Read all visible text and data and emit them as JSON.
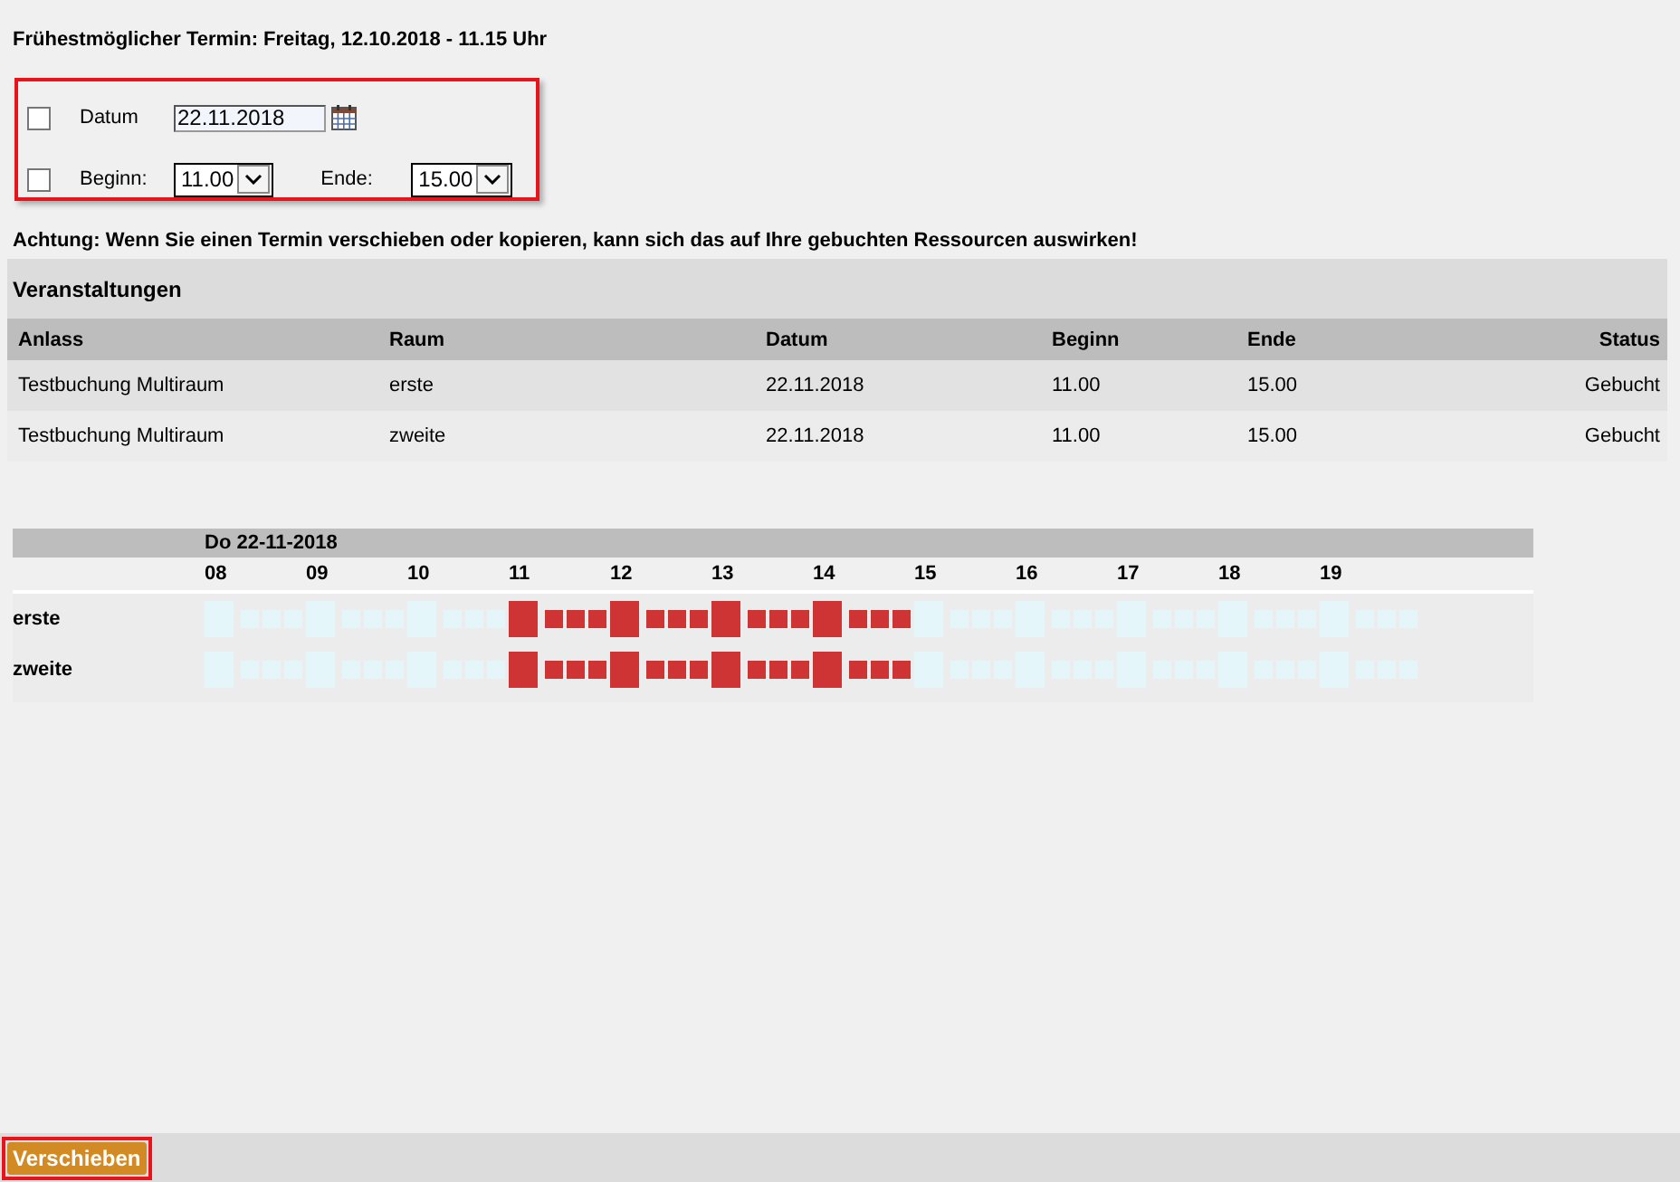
{
  "earliest_slot": "Frühestmöglicher Termin: Freitag, 12.10.2018 - 11.15 Uhr",
  "filter": {
    "date": {
      "label": "Datum",
      "checked": false,
      "value": "22.11.2018"
    },
    "start": {
      "label": "Beginn:",
      "checked": false,
      "value": "11.00"
    },
    "end": {
      "label": "Ende:",
      "value": "15.00"
    }
  },
  "warning": "Achtung: Wenn Sie einen Termin verschieben oder kopieren, kann sich das auf Ihre gebuchten Ressourcen auswirken!",
  "events": {
    "title": "Veranstaltungen",
    "columns": [
      "Anlass",
      "Raum",
      "Datum",
      "Beginn",
      "Ende",
      "Status"
    ],
    "rows": [
      [
        "Testbuchung Multiraum",
        "erste",
        "22.11.2018",
        "11.00",
        "15.00",
        "Gebucht"
      ],
      [
        "Testbuchung Multiraum",
        "zweite",
        "22.11.2018",
        "11.00",
        "15.00",
        "Gebucht"
      ]
    ]
  },
  "timeline": {
    "day": "Do 22-11-2018",
    "hours": [
      "08",
      "09",
      "10",
      "11",
      "12",
      "13",
      "14",
      "15",
      "16",
      "17",
      "18",
      "19"
    ],
    "rooms": [
      {
        "name": "erste",
        "booked": [
          false,
          false,
          false,
          false,
          false,
          false,
          false,
          false,
          false,
          false,
          false,
          false,
          true,
          true,
          true,
          true,
          true,
          true,
          true,
          true,
          true,
          true,
          true,
          true,
          true,
          true,
          true,
          true,
          false,
          false,
          false,
          false,
          false,
          false,
          false,
          false,
          false,
          false,
          false,
          false,
          false,
          false,
          false,
          false,
          false,
          false,
          false,
          false
        ]
      },
      {
        "name": "zweite",
        "booked": [
          false,
          false,
          false,
          false,
          false,
          false,
          false,
          false,
          false,
          false,
          false,
          false,
          true,
          true,
          true,
          true,
          true,
          true,
          true,
          true,
          true,
          true,
          true,
          true,
          true,
          true,
          true,
          true,
          false,
          false,
          false,
          false,
          false,
          false,
          false,
          false,
          false,
          false,
          false,
          false,
          false,
          false,
          false,
          false,
          false,
          false,
          false,
          false
        ]
      }
    ]
  },
  "action_button": "Verschieben"
}
